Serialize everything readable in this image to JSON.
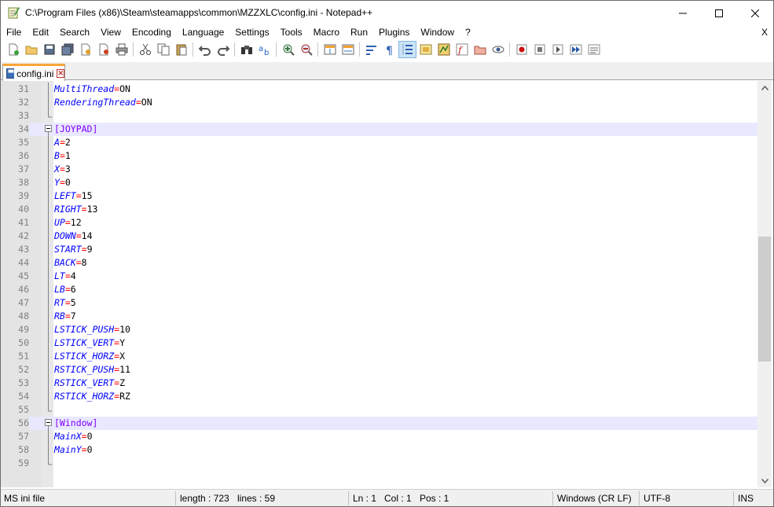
{
  "window": {
    "title": "C:\\Program Files (x86)\\Steam\\steamapps\\common\\MZZXLC\\config.ini - Notepad++"
  },
  "menu": {
    "items": [
      "File",
      "Edit",
      "Search",
      "View",
      "Encoding",
      "Language",
      "Settings",
      "Tools",
      "Macro",
      "Run",
      "Plugins",
      "Window",
      "?"
    ],
    "close_x": "X"
  },
  "toolbar": {
    "buttons": [
      "new-file",
      "open-file",
      "save",
      "save-all",
      "close",
      "close-all",
      "print",
      "cut",
      "copy",
      "paste",
      "undo",
      "redo",
      "find",
      "replace",
      "zoom-in",
      "zoom-out",
      "sync-vertical",
      "sync-horizontal",
      "word-wrap",
      "show-all-chars",
      "indent-guide",
      "udl",
      "doc-map",
      "function-list",
      "folder-as-workspace",
      "monitoring",
      "record-macro",
      "stop-macro",
      "play-macro",
      "run-macro-multiple",
      "save-macro"
    ]
  },
  "tab": {
    "label": "config.ini"
  },
  "editor": {
    "lines": [
      {
        "n": "31",
        "key": "MultiThread",
        "value": "ON"
      },
      {
        "n": "32",
        "key": "RenderingThread",
        "value": "ON"
      },
      {
        "n": "33"
      },
      {
        "n": "34",
        "section": "[JOYPAD]"
      },
      {
        "n": "35",
        "key": "A",
        "value": "2"
      },
      {
        "n": "36",
        "key": "B",
        "value": "1"
      },
      {
        "n": "37",
        "key": "X",
        "value": "3"
      },
      {
        "n": "38",
        "key": "Y",
        "value": "0"
      },
      {
        "n": "39",
        "key": "LEFT",
        "value": "15"
      },
      {
        "n": "40",
        "key": "RIGHT",
        "value": "13"
      },
      {
        "n": "41",
        "key": "UP",
        "value": "12"
      },
      {
        "n": "42",
        "key": "DOWN",
        "value": "14"
      },
      {
        "n": "43",
        "key": "START",
        "value": "9"
      },
      {
        "n": "44",
        "key": "BACK",
        "value": "8"
      },
      {
        "n": "45",
        "key": "LT",
        "value": "4"
      },
      {
        "n": "46",
        "key": "LB",
        "value": "6"
      },
      {
        "n": "47",
        "key": "RT",
        "value": "5"
      },
      {
        "n": "48",
        "key": "RB",
        "value": "7"
      },
      {
        "n": "49",
        "key": "LSTICK_PUSH",
        "value": "10"
      },
      {
        "n": "50",
        "key": "LSTICK_VERT",
        "value": "Y"
      },
      {
        "n": "51",
        "key": "LSTICK_HORZ",
        "value": "X"
      },
      {
        "n": "52",
        "key": "RSTICK_PUSH",
        "value": "11"
      },
      {
        "n": "53",
        "key": "RSTICK_VERT",
        "value": "Z"
      },
      {
        "n": "54",
        "key": "RSTICK_HORZ",
        "value": "RZ"
      },
      {
        "n": "55"
      },
      {
        "n": "56",
        "section": "[Window]"
      },
      {
        "n": "57",
        "key": "MainX",
        "value": "0"
      },
      {
        "n": "58",
        "key": "MainY",
        "value": "0"
      },
      {
        "n": "59"
      }
    ],
    "scroll_position": 0.56,
    "scroll_visible_fraction": 0.33
  },
  "status": {
    "language": "MS ini file",
    "length": "length : 723",
    "lines": "lines : 59",
    "ln": "Ln : 1",
    "col": "Col : 1",
    "pos": "Pos : 1",
    "eol": "Windows (CR LF)",
    "encoding": "UTF-8",
    "mode": "INS"
  },
  "colors": {
    "key": "#0000ff",
    "equals": "#ff0000",
    "section": "#8000ff",
    "section_line_bg": "#e8e8ff",
    "tab_accent": "#f9a63a"
  }
}
